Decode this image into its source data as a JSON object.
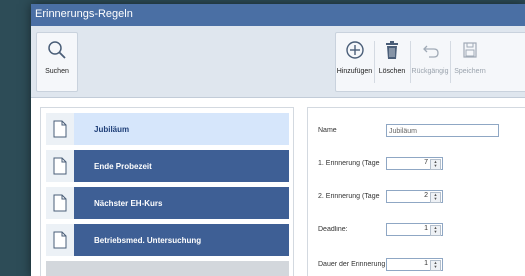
{
  "window": {
    "title": "Erinnerungs-Regeln"
  },
  "toolbar": {
    "search_label": "Suchen",
    "add_label": "Hinzufügen",
    "delete_label": "Löschen",
    "undo_label": "Rückgängig",
    "save_label": "Speichern"
  },
  "list": {
    "items": [
      {
        "label": "Jubiläum",
        "selected": true
      },
      {
        "label": "Ende Probezeit",
        "selected": false
      },
      {
        "label": "Nächster EH-Kurs",
        "selected": false
      },
      {
        "label": "Betriebsmed. Untersuchung",
        "selected": false
      }
    ]
  },
  "form": {
    "name_label": "Name",
    "name_value": "Jubiläum",
    "reminder1_label": "1. Erinnerung (Tage",
    "reminder1_value": "7",
    "reminder2_label": "2. Erinnerung (Tage",
    "reminder2_value": "2",
    "deadline_label": "Deadline:",
    "deadline_value": "1",
    "duration_label": "Dauer der Erinnerung",
    "duration_value": "1"
  },
  "colors": {
    "titlebar": "#4a6fa4",
    "list_item": "#3e5f95",
    "list_item_selected": "#d6e6fb",
    "background": "#2d4c57"
  },
  "icons": {
    "search": "search-icon",
    "add": "plus-circle-icon",
    "delete": "trash-icon",
    "undo": "undo-icon",
    "save": "save-icon",
    "document": "document-icon"
  }
}
